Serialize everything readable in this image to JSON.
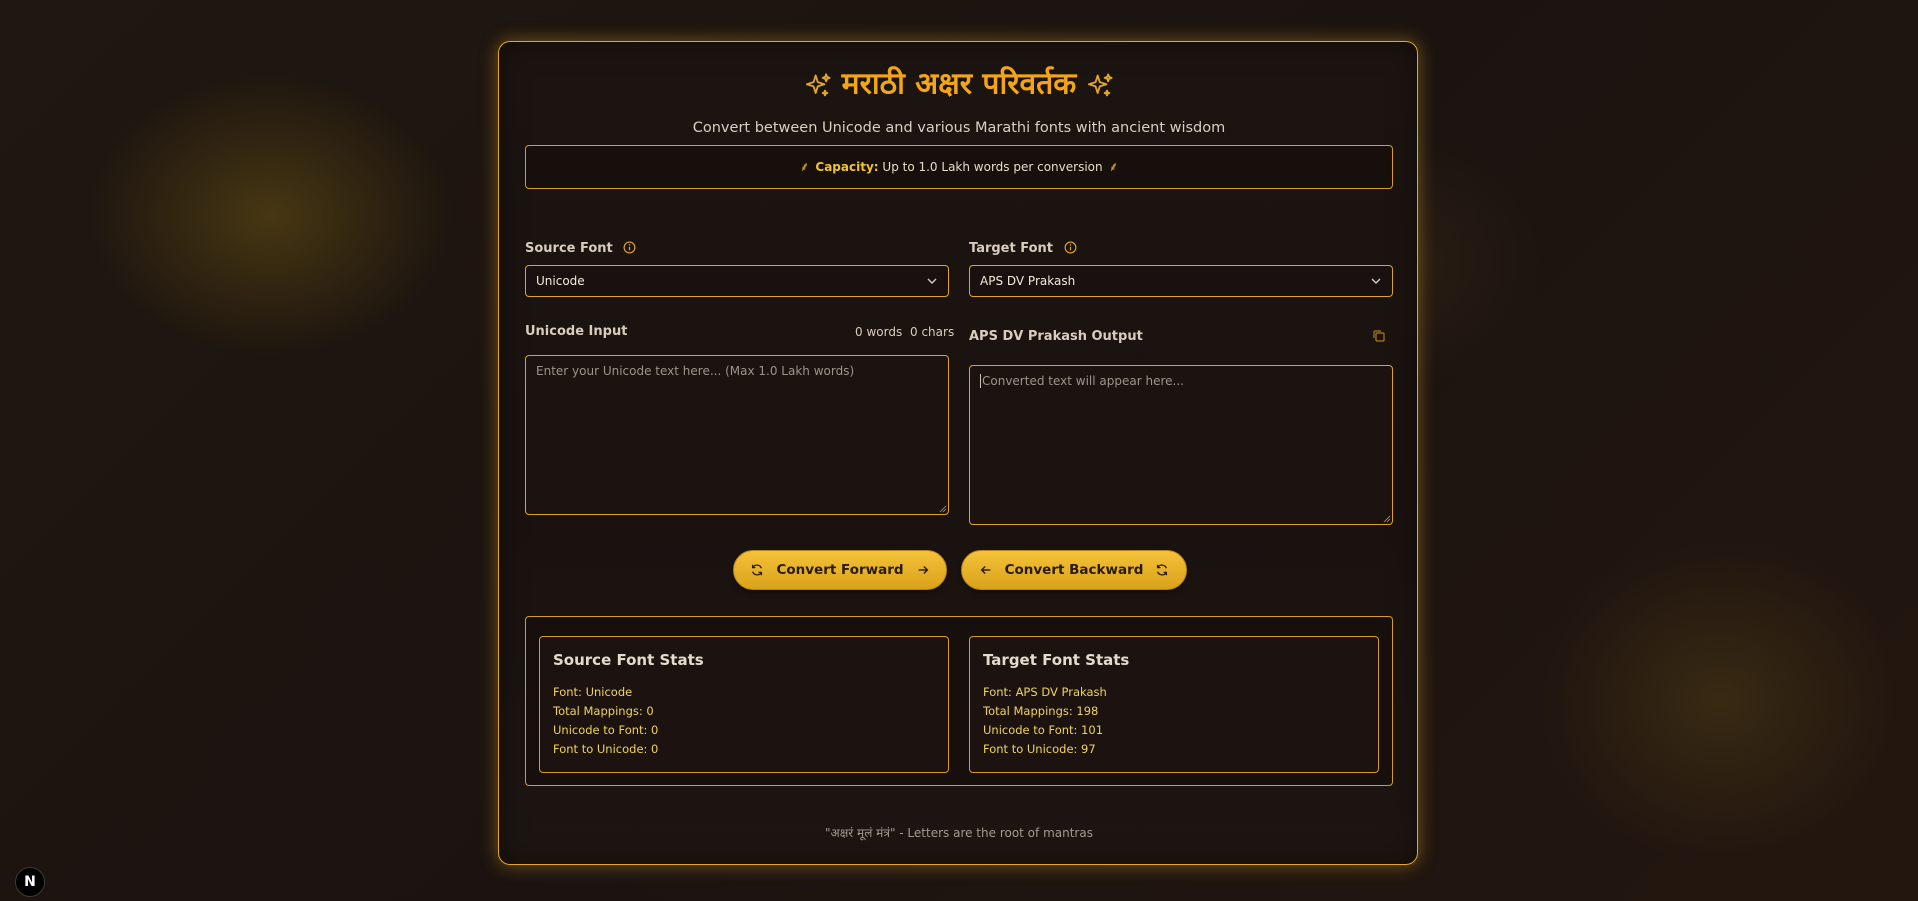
{
  "header": {
    "title": "मराठी अक्षर परिवर्तक",
    "subtitle": "Convert between Unicode and various Marathi fonts with ancient wisdom",
    "capacity_label": "Capacity:",
    "capacity_text": "Up to 1.0 Lakh words per conversion",
    "capacity_icon": "wheat-icon"
  },
  "source": {
    "label": "Source Font",
    "selected": "Unicode",
    "input_label": "Unicode Input",
    "word_count": "0 words",
    "char_count": "0 chars",
    "placeholder": "Enter your Unicode text here... (Max 1.0 Lakh words)",
    "value": ""
  },
  "target": {
    "label": "Target Font",
    "selected": "APS DV Prakash",
    "output_label": "APS DV Prakash Output",
    "placeholder": "Converted text will appear here...",
    "value": ""
  },
  "buttons": {
    "forward": "Convert Forward",
    "backward": "Convert Backward"
  },
  "stats": {
    "source": {
      "title": "Source Font Stats",
      "font": "Font: Unicode",
      "total": "Total Mappings: 0",
      "u2f": "Unicode to Font: 0",
      "f2u": "Font to Unicode: 0"
    },
    "target": {
      "title": "Target Font Stats",
      "font": "Font: APS DV Prakash",
      "total": "Total Mappings: 198",
      "u2f": "Unicode to Font: 101",
      "f2u": "Font to Unicode: 97"
    }
  },
  "footer": {
    "quote": "\"अक्षरं मूलं मंत्रं\" - Letters are the root of mantras"
  },
  "badge": {
    "letter": "N"
  },
  "colors": {
    "accent": "#f2a516",
    "border": "#e1a22b",
    "button": "#f4c23a",
    "stat_text": "#efd35a"
  }
}
